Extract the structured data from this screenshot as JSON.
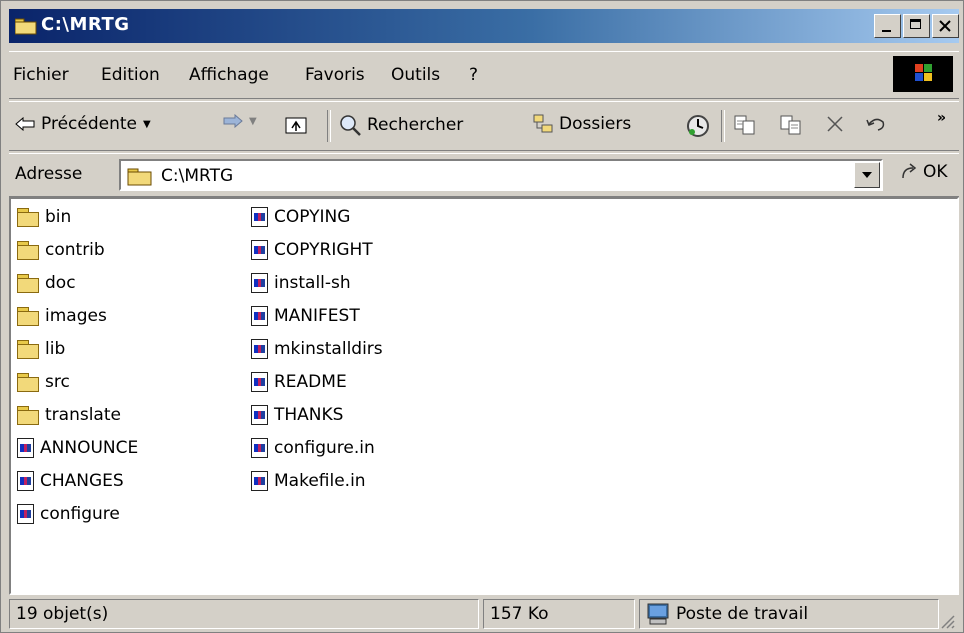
{
  "window": {
    "title": "C:\\MRTG"
  },
  "menu": {
    "items": [
      "Fichier",
      "Edition",
      "Affichage",
      "Favoris",
      "Outils",
      "?"
    ]
  },
  "toolbar": {
    "back": "Précédente",
    "search": "Rechercher",
    "folders": "Dossiers"
  },
  "address": {
    "label": "Adresse",
    "value": "C:\\MRTG",
    "go": "OK"
  },
  "files": {
    "col1": [
      {
        "name": "bin",
        "type": "folder"
      },
      {
        "name": "contrib",
        "type": "folder"
      },
      {
        "name": "doc",
        "type": "folder"
      },
      {
        "name": "images",
        "type": "folder"
      },
      {
        "name": "lib",
        "type": "folder"
      },
      {
        "name": "src",
        "type": "folder"
      },
      {
        "name": "translate",
        "type": "folder"
      },
      {
        "name": "ANNOUNCE",
        "type": "file"
      },
      {
        "name": "CHANGES",
        "type": "file"
      },
      {
        "name": "configure",
        "type": "file"
      }
    ],
    "col2": [
      {
        "name": "COPYING",
        "type": "file"
      },
      {
        "name": "COPYRIGHT",
        "type": "file"
      },
      {
        "name": "install-sh",
        "type": "file"
      },
      {
        "name": "MANIFEST",
        "type": "file"
      },
      {
        "name": "mkinstalldirs",
        "type": "file"
      },
      {
        "name": "README",
        "type": "file"
      },
      {
        "name": "THANKS",
        "type": "file"
      },
      {
        "name": "configure.in",
        "type": "file"
      },
      {
        "name": "Makefile.in",
        "type": "file"
      }
    ]
  },
  "status": {
    "count": "19 objet(s)",
    "size": "157 Ko",
    "zone": "Poste de travail"
  }
}
